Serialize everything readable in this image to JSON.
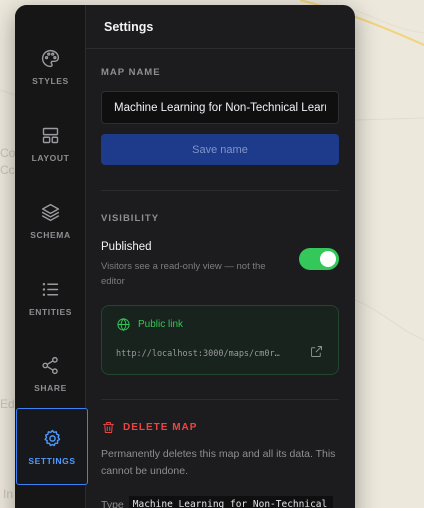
{
  "map_background": {
    "ghost_labels": [
      "Co",
      "Cc",
      "Ed",
      "In"
    ]
  },
  "rail": {
    "items": [
      {
        "label": "STYLES",
        "icon": "palette-icon"
      },
      {
        "label": "LAYOUT",
        "icon": "layout-icon"
      },
      {
        "label": "SCHEMA",
        "icon": "layers-icon"
      },
      {
        "label": "ENTITIES",
        "icon": "list-icon"
      },
      {
        "label": "SHARE",
        "icon": "share-icon"
      },
      {
        "label": "SETTINGS",
        "icon": "gear-icon",
        "active": true
      }
    ]
  },
  "header": {
    "title": "Settings"
  },
  "map_name": {
    "section_label": "MAP NAME",
    "value": "Machine Learning for Non-Technical Learners",
    "save_label": "Save name"
  },
  "visibility": {
    "section_label": "VISIBILITY",
    "published_label": "Published",
    "published_desc": "Visitors see a read-only view — not the editor",
    "published": true,
    "public_link_label": "Public link",
    "public_link_url": "http://localhost:3000/maps/cm0r…"
  },
  "danger": {
    "title": "DELETE MAP",
    "description": "Permanently deletes this map and all its data. This cannot be undone.",
    "confirm_prefix": "Type",
    "confirm_text": "Machine Learning for Non-Technical"
  },
  "colors": {
    "accent": "#3b82f6",
    "success": "#34c759",
    "danger": "#ef4444",
    "panel": "#1c1c1e"
  }
}
